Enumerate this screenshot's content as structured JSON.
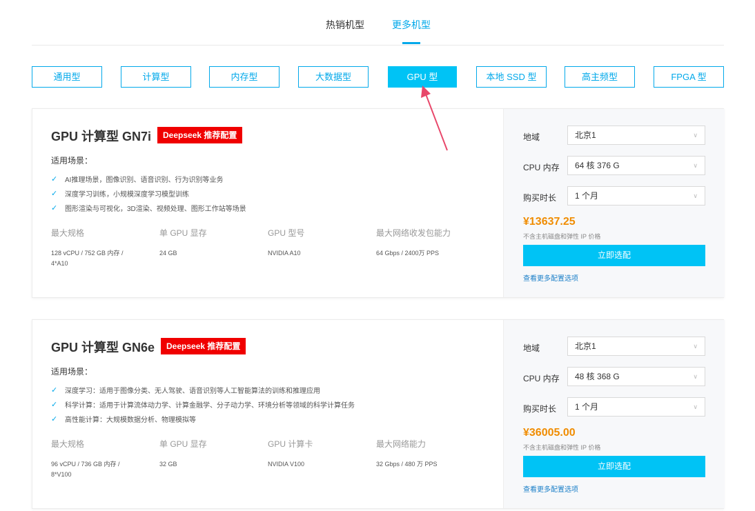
{
  "top_tabs": [
    {
      "label": "热销机型",
      "active": false
    },
    {
      "label": "更多机型",
      "active": true
    }
  ],
  "categories": [
    {
      "label": "通用型",
      "active": false
    },
    {
      "label": "计算型",
      "active": false
    },
    {
      "label": "内存型",
      "active": false
    },
    {
      "label": "大数据型",
      "active": false
    },
    {
      "label": "GPU 型",
      "active": true
    },
    {
      "label": "本地 SSD 型",
      "active": false
    },
    {
      "label": "高主频型",
      "active": false
    },
    {
      "label": "FPGA 型",
      "active": false
    }
  ],
  "colors": {
    "accent": "#00a8ea",
    "button": "#00c3f5",
    "price": "#f08c00",
    "badge": "#f00000",
    "arrow": "#e8476a"
  },
  "cards": [
    {
      "title": "GPU 计算型 GN7i",
      "badge": "Deepseek 推荐配置",
      "scene_label": "适用场景：",
      "scenes": [
        "AI推理场景，图像识别、语音识别、行为识别等业务",
        "深度学习训练，小规模深度学习模型训练",
        "图形渲染与可视化，3D渲染、视频处理、图形工作站等场景"
      ],
      "specs": [
        {
          "key": "最大规格",
          "value": "128 vCPU / 752 GB 内存 / 4*A10"
        },
        {
          "key": "单 GPU 显存",
          "value": "24 GB"
        },
        {
          "key": "GPU 型号",
          "value": "NVIDIA A10"
        },
        {
          "key": "最大网络收发包能力",
          "value": "64 Gbps / 2400万 PPS"
        }
      ],
      "region_label": "地域",
      "region": "北京1",
      "cpu_label": "CPU 内存",
      "cpu": "64 核 376 G",
      "duration_label": "购买时长",
      "duration": "1 个月",
      "price": "¥13637.25",
      "price_note": "不含主机磁盘和弹性 IP 价格",
      "button": "立即选配",
      "more_link": "查看更多配置选项"
    },
    {
      "title": "GPU 计算型 GN6e",
      "badge": "Deepseek 推荐配置",
      "scene_label": "适用场景：",
      "scenes": [
        "深度学习：适用于图像分类、无人驾驶、语音识别等人工智能算法的训练和推理应用",
        "科学计算：适用于计算流体动力学、计算金融学、分子动力学、环境分析等领域的科学计算任务",
        "高性能计算：大规模数据分析、物理模拟等"
      ],
      "specs": [
        {
          "key": "最大规格",
          "value": "96 vCPU / 736 GB 内存 / 8*V100"
        },
        {
          "key": "单 GPU 显存",
          "value": "32 GB"
        },
        {
          "key": "GPU 计算卡",
          "value": "NVIDIA V100"
        },
        {
          "key": "最大网络能力",
          "value": "32 Gbps / 480 万 PPS"
        }
      ],
      "region_label": "地域",
      "region": "北京1",
      "cpu_label": "CPU 内存",
      "cpu": "48 核 368 G",
      "duration_label": "购买时长",
      "duration": "1 个月",
      "price": "¥36005.00",
      "price_note": "不含主机磁盘和弹性 IP 价格",
      "button": "立即选配",
      "more_link": "查看更多配置选项"
    }
  ]
}
